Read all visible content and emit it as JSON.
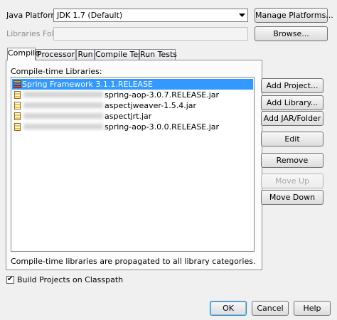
{
  "platform": {
    "label": "Java Platform:",
    "value": "JDK 1.7 (Default)",
    "manage_button": "Manage Platforms..."
  },
  "libraries_folder": {
    "label": "Libraries Folder:",
    "value": "",
    "browse_button": "Browse..."
  },
  "tabs": [
    {
      "label": "Compile",
      "active": true
    },
    {
      "label": "Processor",
      "active": false
    },
    {
      "label": "Run",
      "active": false
    },
    {
      "label": "Compile Tests",
      "active": false
    },
    {
      "label": "Run Tests",
      "active": false
    }
  ],
  "compile": {
    "list_label": "Compile-time Libraries:",
    "items": [
      {
        "text": "Spring Framework 3.1.1.RELEASE",
        "type": "library",
        "selected": true
      },
      {
        "text": "spring-aop-3.0.7.RELEASE.jar",
        "type": "jar",
        "selected": false
      },
      {
        "text": "aspectjweaver-1.5.4.jar",
        "type": "jar",
        "selected": false
      },
      {
        "text": "aspectjrt.jar",
        "type": "jar",
        "selected": false
      },
      {
        "text": "spring-aop-3.0.0.RELEASE.jar",
        "type": "jar",
        "selected": false
      }
    ],
    "buttons": {
      "add_project": "Add Project...",
      "add_library": "Add Library...",
      "add_jar": "Add JAR/Folder",
      "edit": "Edit",
      "remove": "Remove",
      "move_up": "Move Up",
      "move_down": "Move Down"
    },
    "note": "Compile-time libraries are propagated to all library categories."
  },
  "build_projects": {
    "label": "Build Projects on Classpath",
    "checked": true,
    "check_glyph": "✔"
  },
  "footer": {
    "ok": "OK",
    "cancel": "Cancel",
    "help": "Help"
  },
  "colors": {
    "selection": "#3399ff",
    "window_bg": "#f0f0f0"
  },
  "icons": {
    "library": "library-icon",
    "jar": "jar-file-icon",
    "dropdown": "chevron-down-icon"
  }
}
